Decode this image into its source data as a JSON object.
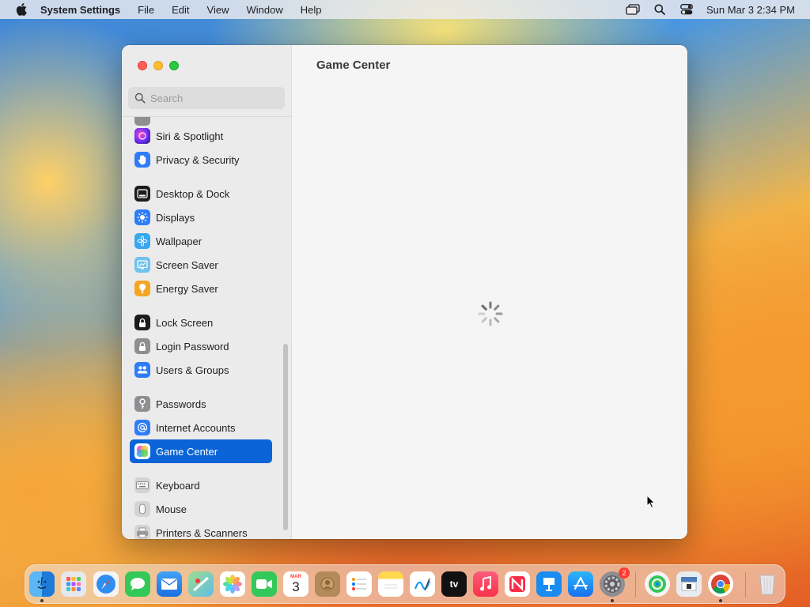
{
  "menubar": {
    "app_name": "System Settings",
    "menus": [
      "File",
      "Edit",
      "View",
      "Window",
      "Help"
    ],
    "clock": "Sun Mar 3  2:34 PM"
  },
  "window": {
    "search": {
      "placeholder": "Search",
      "value": ""
    },
    "sidebar": {
      "items": [
        {
          "label": "Siri & Spotlight",
          "icon": "siri-icon"
        },
        {
          "label": "Privacy & Security",
          "icon": "hand-icon"
        },
        {
          "label": "Desktop & Dock",
          "icon": "dock-icon"
        },
        {
          "label": "Displays",
          "icon": "sun-icon"
        },
        {
          "label": "Wallpaper",
          "icon": "flower-icon"
        },
        {
          "label": "Screen Saver",
          "icon": "screen-saver-icon"
        },
        {
          "label": "Energy Saver",
          "icon": "bulb-icon"
        },
        {
          "label": "Lock Screen",
          "icon": "lock-icon"
        },
        {
          "label": "Login Password",
          "icon": "padlock-icon"
        },
        {
          "label": "Users & Groups",
          "icon": "users-icon"
        },
        {
          "label": "Passwords",
          "icon": "key-icon"
        },
        {
          "label": "Internet Accounts",
          "icon": "at-icon"
        },
        {
          "label": "Game Center",
          "icon": "game-center-icon",
          "selected": true
        },
        {
          "label": "Keyboard",
          "icon": "keyboard-icon"
        },
        {
          "label": "Mouse",
          "icon": "mouse-icon"
        },
        {
          "label": "Printers & Scanners",
          "icon": "printer-icon"
        }
      ]
    },
    "main": {
      "title": "Game Center"
    }
  },
  "dock": {
    "calendar": {
      "month": "MAR",
      "day": "3"
    },
    "tv_label": "tv",
    "settings_badge": "2"
  },
  "colors": {
    "accent": "#0a64d8",
    "tl_red": "#fe5f57",
    "tl_yellow": "#febc2e",
    "tl_green": "#28c840"
  }
}
